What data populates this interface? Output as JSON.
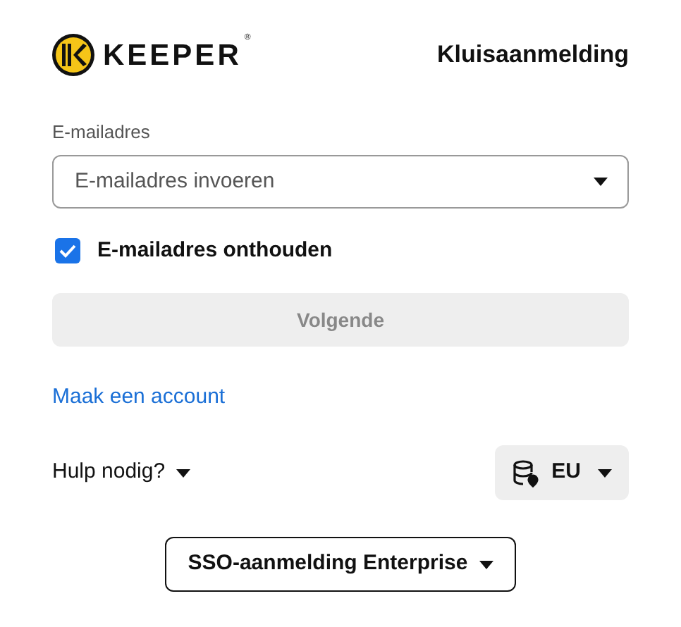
{
  "header": {
    "brand": "KEEPER",
    "brand_mark": "®",
    "title": "Kluisaanmelding"
  },
  "email": {
    "label": "E-mailadres",
    "placeholder": "E-mailadres invoeren"
  },
  "remember": {
    "label": "E-mailadres onthouden",
    "checked": true
  },
  "next_button": {
    "label": "Volgende",
    "disabled": true
  },
  "create_account_link": "Maak een account",
  "help_menu": "Hulp nodig?",
  "region_button": "EU",
  "sso_button": "SSO-aanmelding Enterprise"
}
